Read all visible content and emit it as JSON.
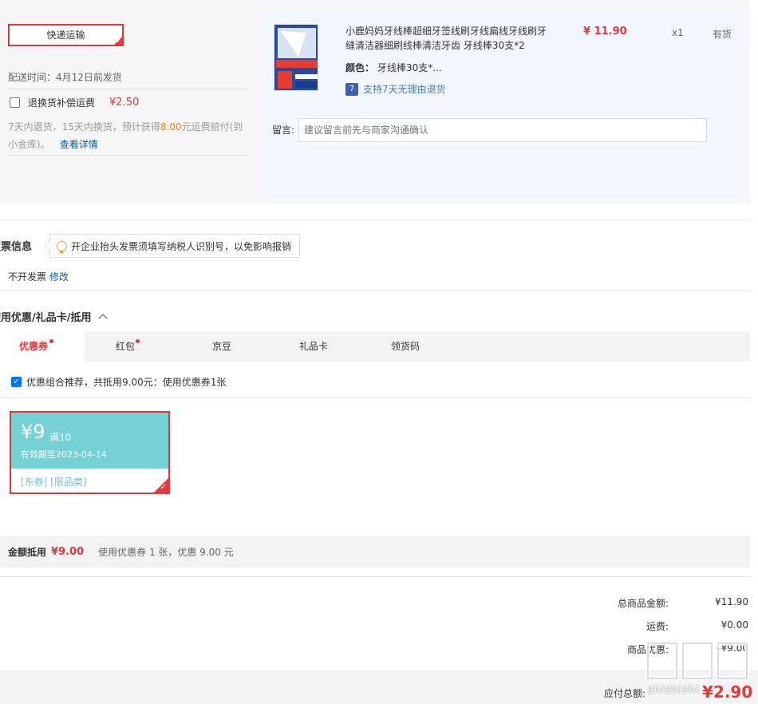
{
  "shipping": {
    "method_label": "快递运输",
    "delivery_time": "配送时间：4月12日前发货",
    "return_insurance_label": "退换货补偿运费",
    "return_insurance_price": "¥2.50",
    "insurance_desc_pre": "7天内退货，15天内换货，预计获得",
    "insurance_desc_amount": "8.00",
    "insurance_desc_post": "元运费赔付(到小金库)。",
    "insurance_detail_link": "查看详情"
  },
  "product": {
    "name": "小鹿妈妈牙线棒超细牙签线刷牙线扁线牙线刷牙缝清洁器细刷线棒清洁牙齿 牙线棒30支*2",
    "price": "¥ 11.90",
    "qty": "x1",
    "stock": "有货",
    "color_label": "颜色：",
    "color_value": "牙线棒30支*...",
    "return_policy": "支持7天无理由退货",
    "remark_label": "留言:",
    "remark_placeholder": "建议留言前先与商家沟通确认"
  },
  "invoice": {
    "title": "发票信息",
    "tip": "开企业抬头发票须填写纳税人识别号，以免影响报销",
    "value": "不开发票",
    "edit_link": "修改"
  },
  "coupons": {
    "title": "使用优惠/礼品卡/抵用",
    "tabs": [
      "优惠券",
      "红包",
      "京豆",
      "礼品卡",
      "领货码"
    ],
    "combo_label": "优惠组合推荐，共抵用9.00元：使用优惠券1张",
    "coupon": {
      "amount": "¥9",
      "condition": "满10",
      "valid": "有效期至2023-04-14",
      "tags": "[东券] [限品类]"
    },
    "deduct_label": "金额抵用",
    "deduct_amount": "¥9.00",
    "deduct_note": "使用优惠券 1 张，优惠 9.00 元"
  },
  "summary": {
    "goods_label": "总商品金额:",
    "goods_value": "¥11.90",
    "freight_label": "运费:",
    "freight_value": "¥0.00",
    "discount_label": "商品优惠:",
    "discount_value": "-¥9.00",
    "total_label": "应付总额:",
    "total_value": "¥2.90"
  },
  "watermark": "zhizhizhi",
  "colors": {
    "accent_red": "#e4393c",
    "link_blue": "#005ea7",
    "coupon_teal": "#74d2d4"
  }
}
